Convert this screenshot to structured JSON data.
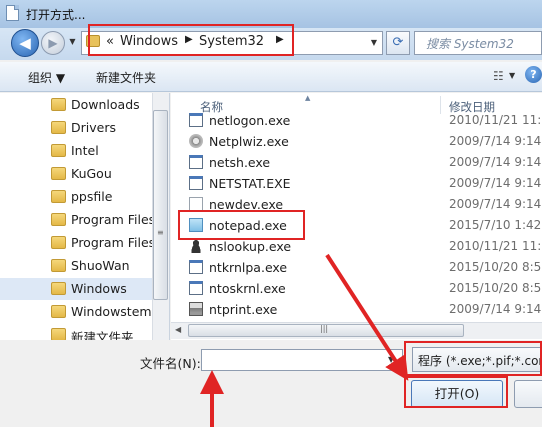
{
  "window": {
    "title": "打开方式..."
  },
  "address": {
    "part1": "Windows",
    "part2": "System32",
    "chevron": "«",
    "separator": "▶"
  },
  "search": {
    "placeholder": "搜索 System32"
  },
  "toolbar": {
    "organize": "组织 ▼",
    "new_folder": "新建文件夹"
  },
  "nav": {
    "items": [
      {
        "label": "Downloads"
      },
      {
        "label": "Drivers"
      },
      {
        "label": "Intel"
      },
      {
        "label": "KuGou"
      },
      {
        "label": "ppsfile"
      },
      {
        "label": "Program Files"
      },
      {
        "label": "Program Files"
      },
      {
        "label": "ShuoWan"
      },
      {
        "label": "Windows"
      },
      {
        "label": "Windowstemp"
      },
      {
        "label": "新建文件夹"
      }
    ]
  },
  "files": {
    "columns": {
      "name": "名称",
      "date": "修改日期"
    },
    "rows": [
      {
        "name": "netlogon.exe",
        "date": "2010/11/21 11:2",
        "icon": "app-icon"
      },
      {
        "name": "Netplwiz.exe",
        "date": "2009/7/14 9:14",
        "icon": "users-icon"
      },
      {
        "name": "netsh.exe",
        "date": "2009/7/14 9:14",
        "icon": "app-icon"
      },
      {
        "name": "NETSTAT.EXE",
        "date": "2009/7/14 9:14",
        "icon": "app-icon"
      },
      {
        "name": "newdev.exe",
        "date": "2009/7/14 9:14",
        "icon": "doc-icon"
      },
      {
        "name": "notepad.exe",
        "date": "2015/7/10 1:42",
        "icon": "notepad-icon"
      },
      {
        "name": "nslookup.exe",
        "date": "2010/11/21 11:2",
        "icon": "person-icon"
      },
      {
        "name": "ntkrnlpa.exe",
        "date": "2015/10/20 8:53",
        "icon": "app-icon"
      },
      {
        "name": "ntoskrnl.exe",
        "date": "2015/10/20 8:53",
        "icon": "app-icon"
      },
      {
        "name": "ntprint.exe",
        "date": "2009/7/14 9:14",
        "icon": "printer-icon"
      }
    ]
  },
  "bottom": {
    "filename_label": "文件名(N):",
    "filename_value": "",
    "filetype": "程序 (*.exe;*.pif;*.com",
    "open_label": "打开(O)"
  },
  "colors": {
    "annotation": "#e02424",
    "selection": "#dde8f6"
  }
}
